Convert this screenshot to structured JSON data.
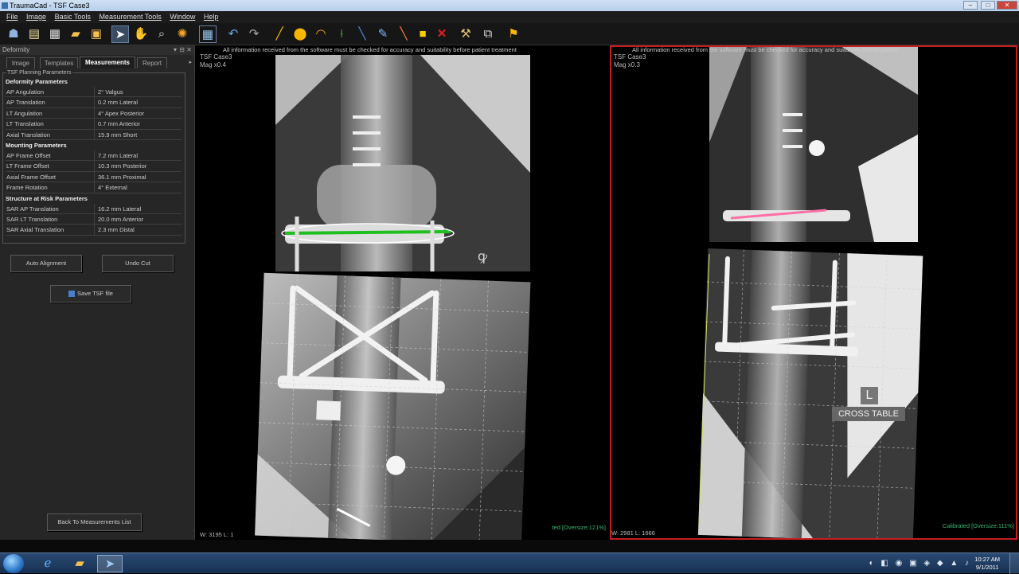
{
  "window": {
    "title": "TraumaCad - TSF Case3",
    "minimize": "–",
    "maximize": "□",
    "close": "✕"
  },
  "menu": [
    "File",
    "Image",
    "Basic Tools",
    "Measurement Tools",
    "Window",
    "Help"
  ],
  "toolbar": {
    "icons": [
      "users-icon",
      "folder-new-icon",
      "calendar-icon",
      "folder-open-icon",
      "save-icon",
      "pointer-icon",
      "hand-icon",
      "zoom-icon",
      "brightness-icon",
      "layout-icon",
      "undo-icon",
      "redo-icon",
      "line-icon",
      "circle-icon",
      "arc-icon",
      "angle-icon",
      "segment-icon",
      "pen-icon",
      "ruler-icon",
      "note-icon",
      "delete-icon",
      "tools-icon",
      "export-icon",
      "wizard-icon"
    ]
  },
  "sidebar": {
    "panel_title": "Deformity",
    "panel_controls": [
      "▾",
      "⊟",
      "✕"
    ],
    "tabs": [
      "Image",
      "Templates",
      "Measurements",
      "Report"
    ],
    "active_tab": "Measurements",
    "group_title": "TSF Planning Parameters",
    "sections": [
      {
        "title": "Deformity Parameters",
        "rows": [
          {
            "k": "AP Angulation",
            "v": "2° Valgus"
          },
          {
            "k": "AP Translation",
            "v": "0.2 mm Lateral"
          },
          {
            "k": "LT Angulation",
            "v": "4° Apex Posterior"
          },
          {
            "k": "LT Translation",
            "v": "0.7 mm Anterior"
          },
          {
            "k": "Axial Translation",
            "v": "15.9 mm Short"
          }
        ]
      },
      {
        "title": "Mounting Parameters",
        "rows": [
          {
            "k": "AP Frame Offset",
            "v": "7.2 mm Lateral"
          },
          {
            "k": "LT Frame Offset",
            "v": "10.3 mm Posterior"
          },
          {
            "k": "Axial Frame Offset",
            "v": "36.1 mm Proximal"
          },
          {
            "k": "Frame Rotation",
            "v": "4° External"
          }
        ]
      },
      {
        "title": "Structure at Risk Parameters",
        "rows": [
          {
            "k": "SAR AP Translation",
            "v": "16.2 mm Lateral"
          },
          {
            "k": "SAR LT Translation",
            "v": "20.0 mm Anterior"
          },
          {
            "k": "SAR Axial Translation",
            "v": "2.3 mm Distal"
          }
        ]
      }
    ],
    "auto_alignment": "Auto Alignment",
    "undo_cut": "Undo Cut",
    "save_tsf": "Save TSF file",
    "back": "Back To Measurements List"
  },
  "left_viewer": {
    "case": "TSF Case3",
    "mag": "Mag x0.4",
    "warning": "All information received from the software must be checked for accuracy and suitability before patient treatment",
    "footer": "W: 3195 L: 1",
    "status": "ted [Oversize:121%]"
  },
  "right_viewer": {
    "case": "TSF Case3",
    "mag": "Mag x0.3",
    "warning": "All information received from the software must be checked for accuracy and suitability before patient",
    "footer": "W: 2981 L: 1666",
    "status": "Calibrated [Oversize:111%]",
    "marker_letter": "L",
    "marker_text": "CROSS TABLE"
  },
  "taskbar": {
    "apps": [
      "ie-icon",
      "explorer-icon",
      "traumacad-icon"
    ],
    "tray_icons": "◐ ◧ ◉ ▣ ◈ ◆ ▲ ♪",
    "time": "10:27 AM",
    "date": "9/1/2011"
  },
  "colors": {
    "frame_red": "#c41e1e",
    "status_green": "#3cb371",
    "title_blue": "#b6cfeb"
  }
}
